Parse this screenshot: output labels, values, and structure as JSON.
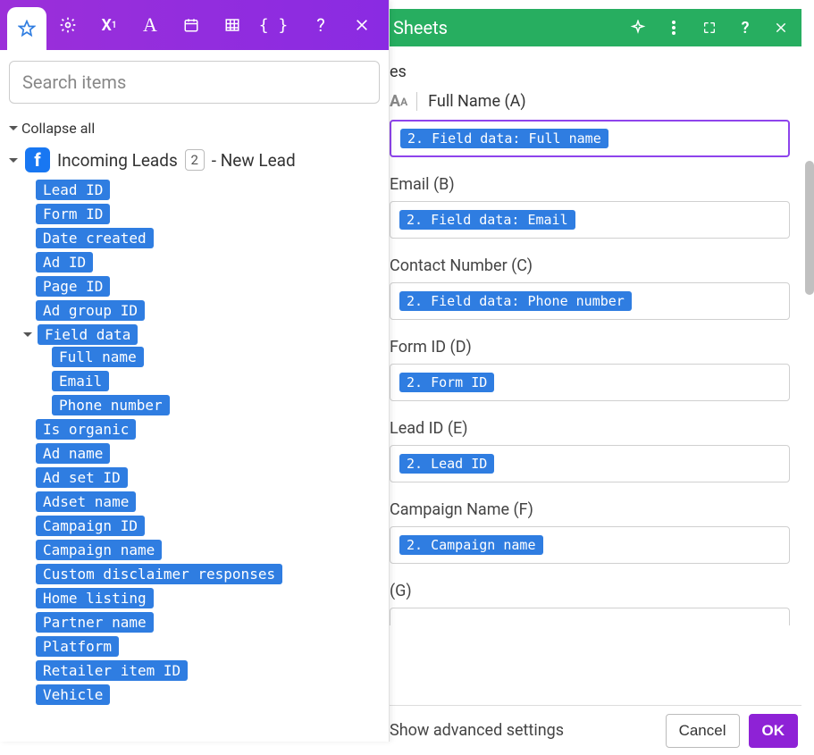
{
  "header": {
    "title": "Sheets"
  },
  "subheader": "es",
  "column_selector": {
    "glyph": "A",
    "label": "Full Name (A)"
  },
  "fields": [
    {
      "label": "",
      "pill": "2. Field data: Full name",
      "active": true
    },
    {
      "label": "Email (B)",
      "pill": "2. Field data: Email"
    },
    {
      "label": "Contact Number (C)",
      "pill": "2. Field data: Phone number"
    },
    {
      "label": "Form ID (D)",
      "pill": "2. Form ID"
    },
    {
      "label": "Lead ID (E)",
      "pill": "2. Lead ID"
    },
    {
      "label": "Campaign Name (F)",
      "pill": "2. Campaign name"
    },
    {
      "label": "(G)",
      "pill": ""
    }
  ],
  "footer": {
    "advanced": "Show advanced settings",
    "cancel": "Cancel",
    "ok": "OK"
  },
  "sidebar": {
    "search_placeholder": "Search items",
    "collapse": "Collapse all",
    "trigger_title_a": "Incoming Leads",
    "trigger_badge": "2",
    "trigger_title_b": "- New Lead",
    "items": [
      "Lead ID",
      "Form ID",
      "Date created",
      "Ad ID",
      "Page ID",
      "Ad group ID"
    ],
    "field_data_label": "Field data",
    "field_data_children": [
      "Full name",
      "Email",
      "Phone number"
    ],
    "items_after": [
      "Is organic",
      "Ad name",
      "Ad set ID",
      "Adset name",
      "Campaign ID",
      "Campaign name",
      "Custom disclaimer responses",
      "Home listing",
      "Partner name",
      "Platform",
      "Retailer item ID",
      "Vehicle"
    ]
  }
}
